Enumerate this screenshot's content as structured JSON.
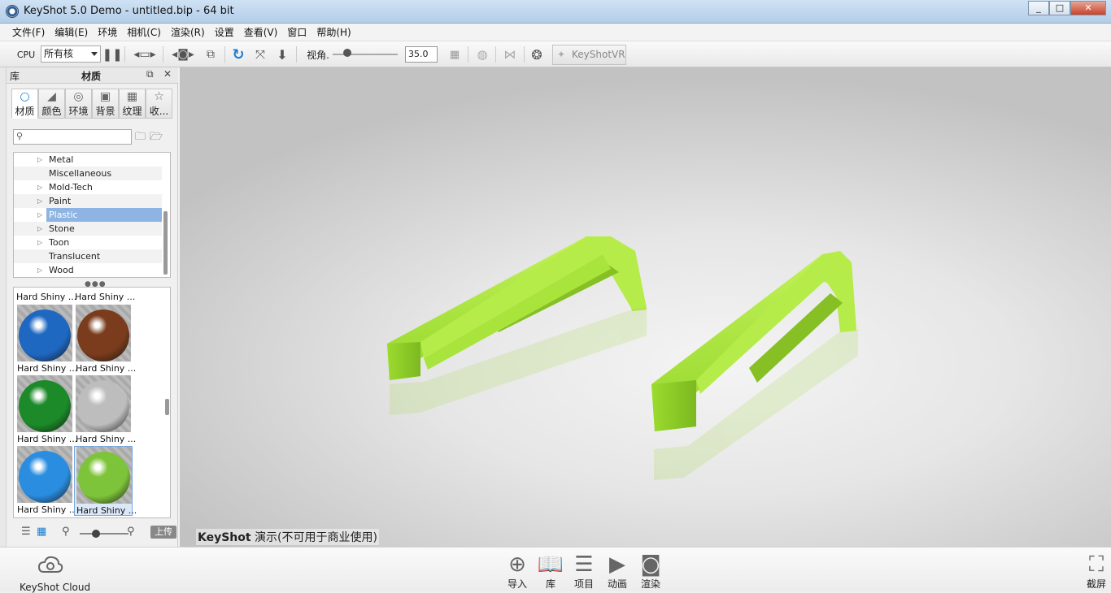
{
  "window": {
    "title": "KeyShot 5.0 Demo  - untitled.bip  - 64 bit",
    "minimize": "_",
    "maximize": "□",
    "close": "✕"
  },
  "menu": [
    "文件(F)",
    "编辑(E)",
    "环境",
    "相机(C)",
    "渲染(R)",
    "设置",
    "查看(V)",
    "窗口",
    "帮助(H)"
  ],
  "toolbar": {
    "cpu_label": "CPU",
    "cpu_value": "所有核",
    "fov_label": "视角.",
    "fov_value": "35.0",
    "vr_label": "KeyShotVR"
  },
  "library": {
    "panel_label": "库",
    "panel_title": "材质",
    "tabs": [
      {
        "icon": "○",
        "label": "材质"
      },
      {
        "icon": "◢",
        "label": "颜色"
      },
      {
        "icon": "◎",
        "label": "环境"
      },
      {
        "icon": "▣",
        "label": "背景"
      },
      {
        "icon": "▦",
        "label": "纹理"
      },
      {
        "icon": "☆",
        "label": "收..."
      }
    ],
    "search_placeholder": "",
    "tree": [
      {
        "label": "Metal",
        "arrow": true
      },
      {
        "label": "Miscellaneous",
        "arrow": false
      },
      {
        "label": "Mold-Tech",
        "arrow": true
      },
      {
        "label": "Paint",
        "arrow": true
      },
      {
        "label": "Plastic",
        "arrow": true,
        "selected": true
      },
      {
        "label": "Stone",
        "arrow": true
      },
      {
        "label": "Toon",
        "arrow": true
      },
      {
        "label": "Translucent",
        "arrow": false
      },
      {
        "label": "Wood",
        "arrow": true
      }
    ],
    "thumbs_top": [
      "Hard Shiny ...",
      "Hard Shiny ..."
    ],
    "thumbs": [
      {
        "label": "Hard Shiny ...",
        "color": "#1f68c2"
      },
      {
        "label": "Hard Shiny ...",
        "color": "#7a3c1c"
      },
      {
        "label": "Hard Shiny ...",
        "color": "#1c8a28"
      },
      {
        "label": "Hard Shiny ...",
        "color": "#bdbdbd"
      },
      {
        "label": "Hard Shiny ...",
        "color": "#2a8de0"
      },
      {
        "label": "Hard Shiny ...",
        "color": "#7ec43a",
        "selected": true
      }
    ],
    "upload_label": "上传"
  },
  "viewport": {
    "watermark_bold": "KeyShot",
    "watermark_text": " 演示(不可用于商业使用)",
    "model_color": "#a6e83a"
  },
  "bottombar": {
    "cloud_label": "KeyShot Cloud",
    "items": [
      {
        "label": "导入",
        "icon": "⊕"
      },
      {
        "label": "库",
        "icon": "📖",
        "active": true
      },
      {
        "label": "项目",
        "icon": "☰"
      },
      {
        "label": "动画",
        "icon": "▶"
      },
      {
        "label": "渲染",
        "icon": "◙"
      }
    ],
    "screenshot_label": "截屏"
  }
}
